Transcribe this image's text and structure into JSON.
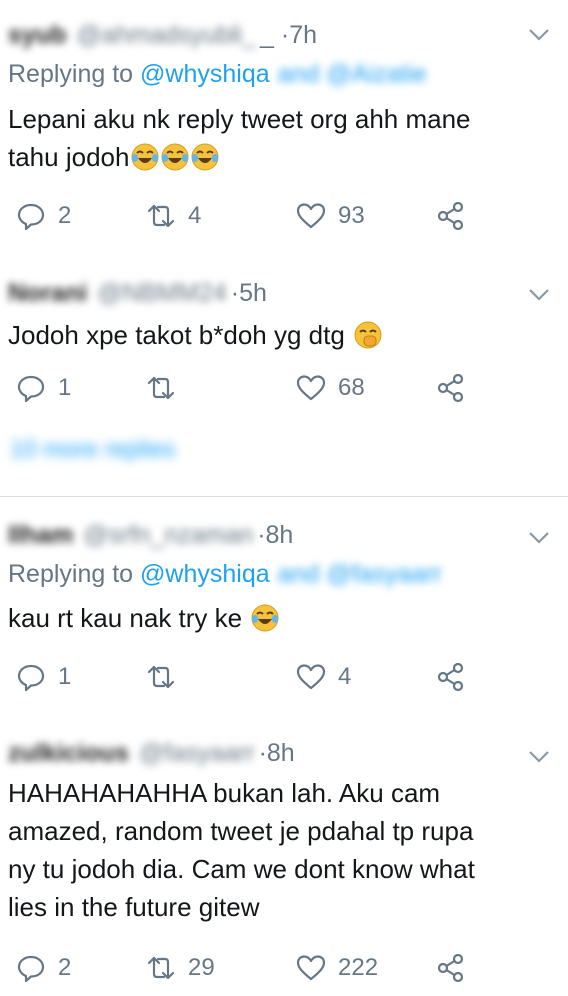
{
  "tweets": [
    {
      "name": "syub",
      "handle": "@ahmadsyubli_",
      "dot": "_ · ",
      "time": "7h",
      "replying_prefix": "Replying to ",
      "replying_handle": "@whyshiqa",
      "replying_more": "and @Aizatie",
      "text_lines": [
        "Lepani aku nk reply tweet org ahh mane",
        "tahu jodoh"
      ],
      "emoji_count": 3,
      "replies": "2",
      "retweets": "4",
      "likes": "93"
    },
    {
      "name": "Norani",
      "handle": "@NBMM24",
      "dot": " · ",
      "time": "5h",
      "text_lines": [
        "Jodoh xpe takot b*doh yg dtg"
      ],
      "replies": "1",
      "retweets": "",
      "likes": "68",
      "more_replies": "10 more replies"
    },
    {
      "name": "Ilham",
      "handle": "@srfn_nzaman",
      "dot": " · ",
      "time": "8h",
      "replying_prefix": "Replying to ",
      "replying_handle": "@whyshiqa",
      "replying_more": "and @fasyaarr",
      "text_lines": [
        "kau rt kau nak try ke"
      ],
      "replies": "1",
      "retweets": "",
      "likes": "4"
    },
    {
      "name": "zulkicious",
      "handle": "@fasyaarr",
      "dot": " · ",
      "time": "8h",
      "text_lines": [
        "HAHAHAHAHHA bukan lah. Aku cam",
        "amazed, random tweet je pdahal tp rupa",
        "ny tu jodoh dia. Cam we dont know what",
        "lies in the future gitew"
      ],
      "replies": "2",
      "retweets": "29",
      "likes": "222"
    }
  ],
  "icons": {
    "reply": "reply-icon",
    "retweet": "retweet-icon",
    "like": "heart-icon",
    "share": "share-icon",
    "caret": "chevron-down-icon"
  },
  "colors": {
    "accent": "#1da1f2",
    "muted": "#657786",
    "text": "#14171a"
  }
}
